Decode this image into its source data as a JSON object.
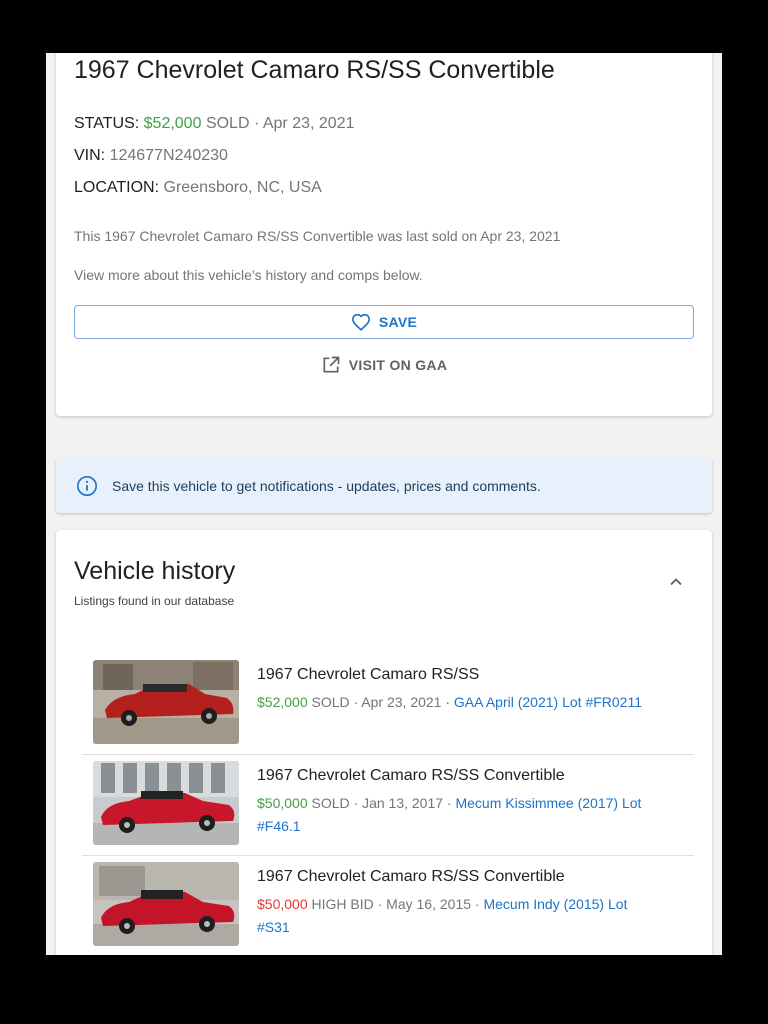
{
  "vehicle": {
    "title": "1967 Chevrolet Camaro RS/SS Convertible",
    "status_label": "STATUS:",
    "status_price": "$52,000",
    "status_state": "SOLD",
    "status_date": "· Apr 23, 2021",
    "vin_label": "VIN:",
    "vin": "124677N240230",
    "location_label": "LOCATION:",
    "location": "Greensboro, NC, USA",
    "desc1": "This 1967 Chevrolet Camaro RS/SS Convertible was last sold on Apr 23, 2021",
    "desc2": "View more about this vehicle's history and comps below.",
    "save_label": "SAVE",
    "visit_label": "VISIT ON GAA"
  },
  "notice": {
    "text": "Save this vehicle to get notifications - updates, prices and comments."
  },
  "history": {
    "title": "Vehicle history",
    "subtitle": "Listings found in our database",
    "items": [
      {
        "title": "1967 Chevrolet Camaro RS/SS",
        "price": "$52,000",
        "state": "SOLD",
        "date": "· Apr 23, 2021 ·",
        "link": "GAA April (2021) Lot #FR0211",
        "price_color": "#43a047"
      },
      {
        "title": "1967 Chevrolet Camaro RS/SS Convertible",
        "price": "$50,000",
        "state": "SOLD",
        "date": "· Jan 13, 2017 ·",
        "link": "Mecum Kissimmee (2017) Lot #F46.1",
        "price_color": "#43a047"
      },
      {
        "title": "1967 Chevrolet Camaro RS/SS Convertible",
        "price": "$50,000",
        "state": "HIGH BID",
        "date": "· May 16, 2015 ·",
        "link": "Mecum Indy (2015) Lot #S31",
        "price_color": "#e53935"
      }
    ]
  },
  "icons": {
    "heart": "heart-outline-icon",
    "external": "open-in-new-icon",
    "info": "info-icon",
    "chevron": "chevron-up-icon"
  },
  "colors": {
    "accent": "#1e73c9",
    "sold": "#43a047",
    "bid": "#e53935",
    "notice_bg": "#e8f1fb"
  }
}
